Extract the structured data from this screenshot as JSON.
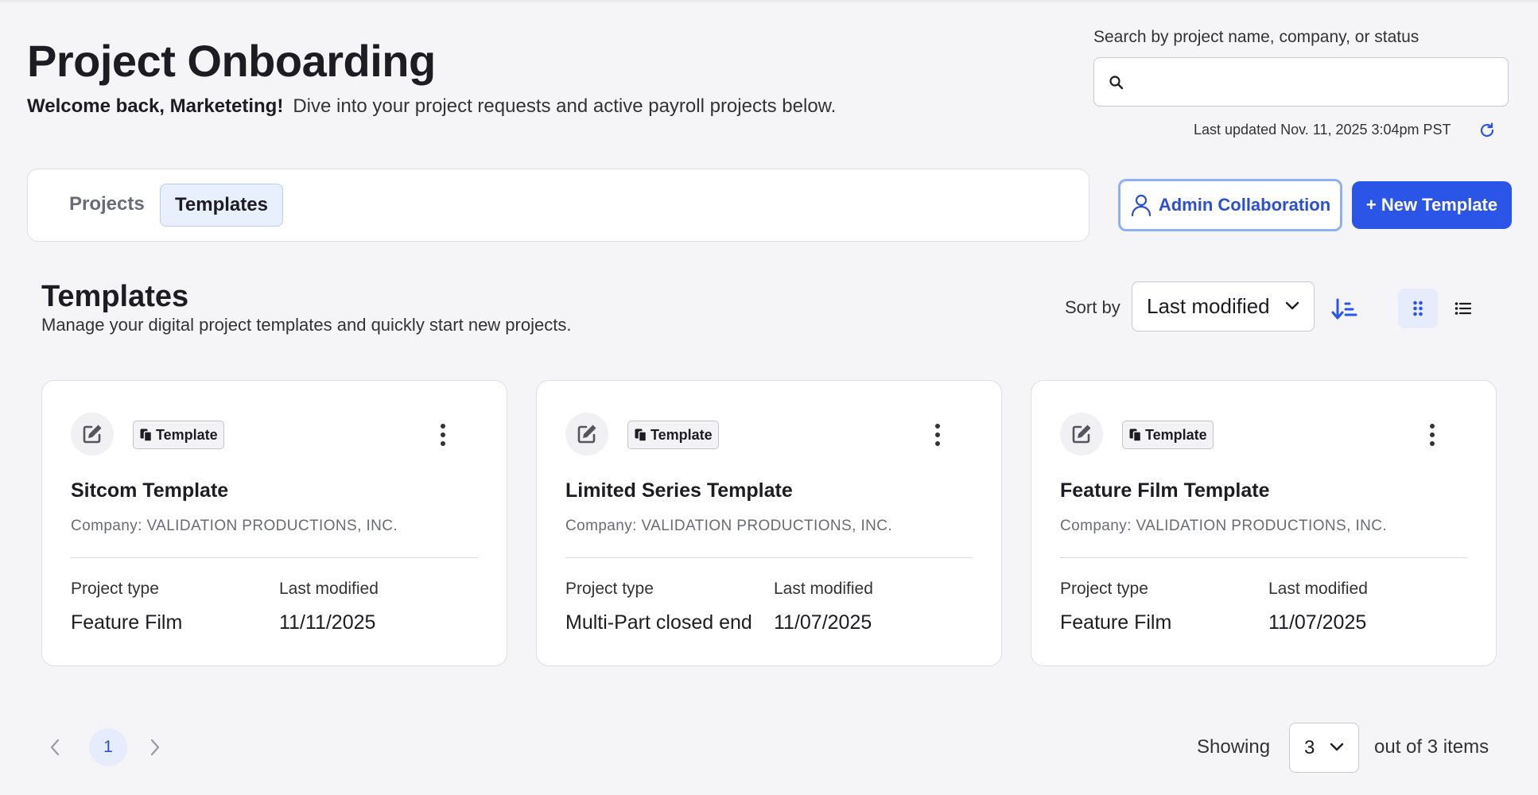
{
  "header": {
    "title": "Project Onboarding",
    "welcome_bold": "Welcome back, Marketeting!",
    "welcome_text": "Dive into your project requests and active payroll projects below."
  },
  "search": {
    "label": "Search by project name, company, or status",
    "value": "",
    "placeholder": ""
  },
  "last_updated": "Last updated Nov. 11, 2025 3:04pm PST",
  "tabs": [
    {
      "label": "Projects",
      "active": false
    },
    {
      "label": "Templates",
      "active": true
    }
  ],
  "actions": {
    "admin_collab_label": "Admin Collaboration",
    "new_template_label": "+ New Template"
  },
  "section": {
    "title": "Templates",
    "subtitle": "Manage your digital project templates and quickly start new projects."
  },
  "sort": {
    "label": "Sort by",
    "selected": "Last modified",
    "view_mode": "grid"
  },
  "cards": [
    {
      "badge": "Template",
      "title": "Sitcom Template",
      "company": "Company: VALIDATION PRODUCTIONS, INC.",
      "type_label": "Project type",
      "type_value": "Feature Film",
      "modified_label": "Last modified",
      "modified_value": "11/11/2025"
    },
    {
      "badge": "Template",
      "title": "Limited Series Template",
      "company": "Company: VALIDATION PRODUCTIONS, INC.",
      "type_label": "Project type",
      "type_value": "Multi-Part closed end",
      "modified_label": "Last modified",
      "modified_value": "11/07/2025"
    },
    {
      "badge": "Template",
      "title": "Feature Film Template",
      "company": "Company: VALIDATION PRODUCTIONS, INC.",
      "type_label": "Project type",
      "type_value": "Feature Film",
      "modified_label": "Last modified",
      "modified_value": "11/07/2025"
    }
  ],
  "pagination": {
    "current_page": "1",
    "showing_label": "Showing",
    "page_size": "3",
    "total_label": "out of 3 items"
  },
  "colors": {
    "accent": "#2a55e6",
    "accent_light": "#e6ecfb",
    "background": "#f5f5f8"
  }
}
